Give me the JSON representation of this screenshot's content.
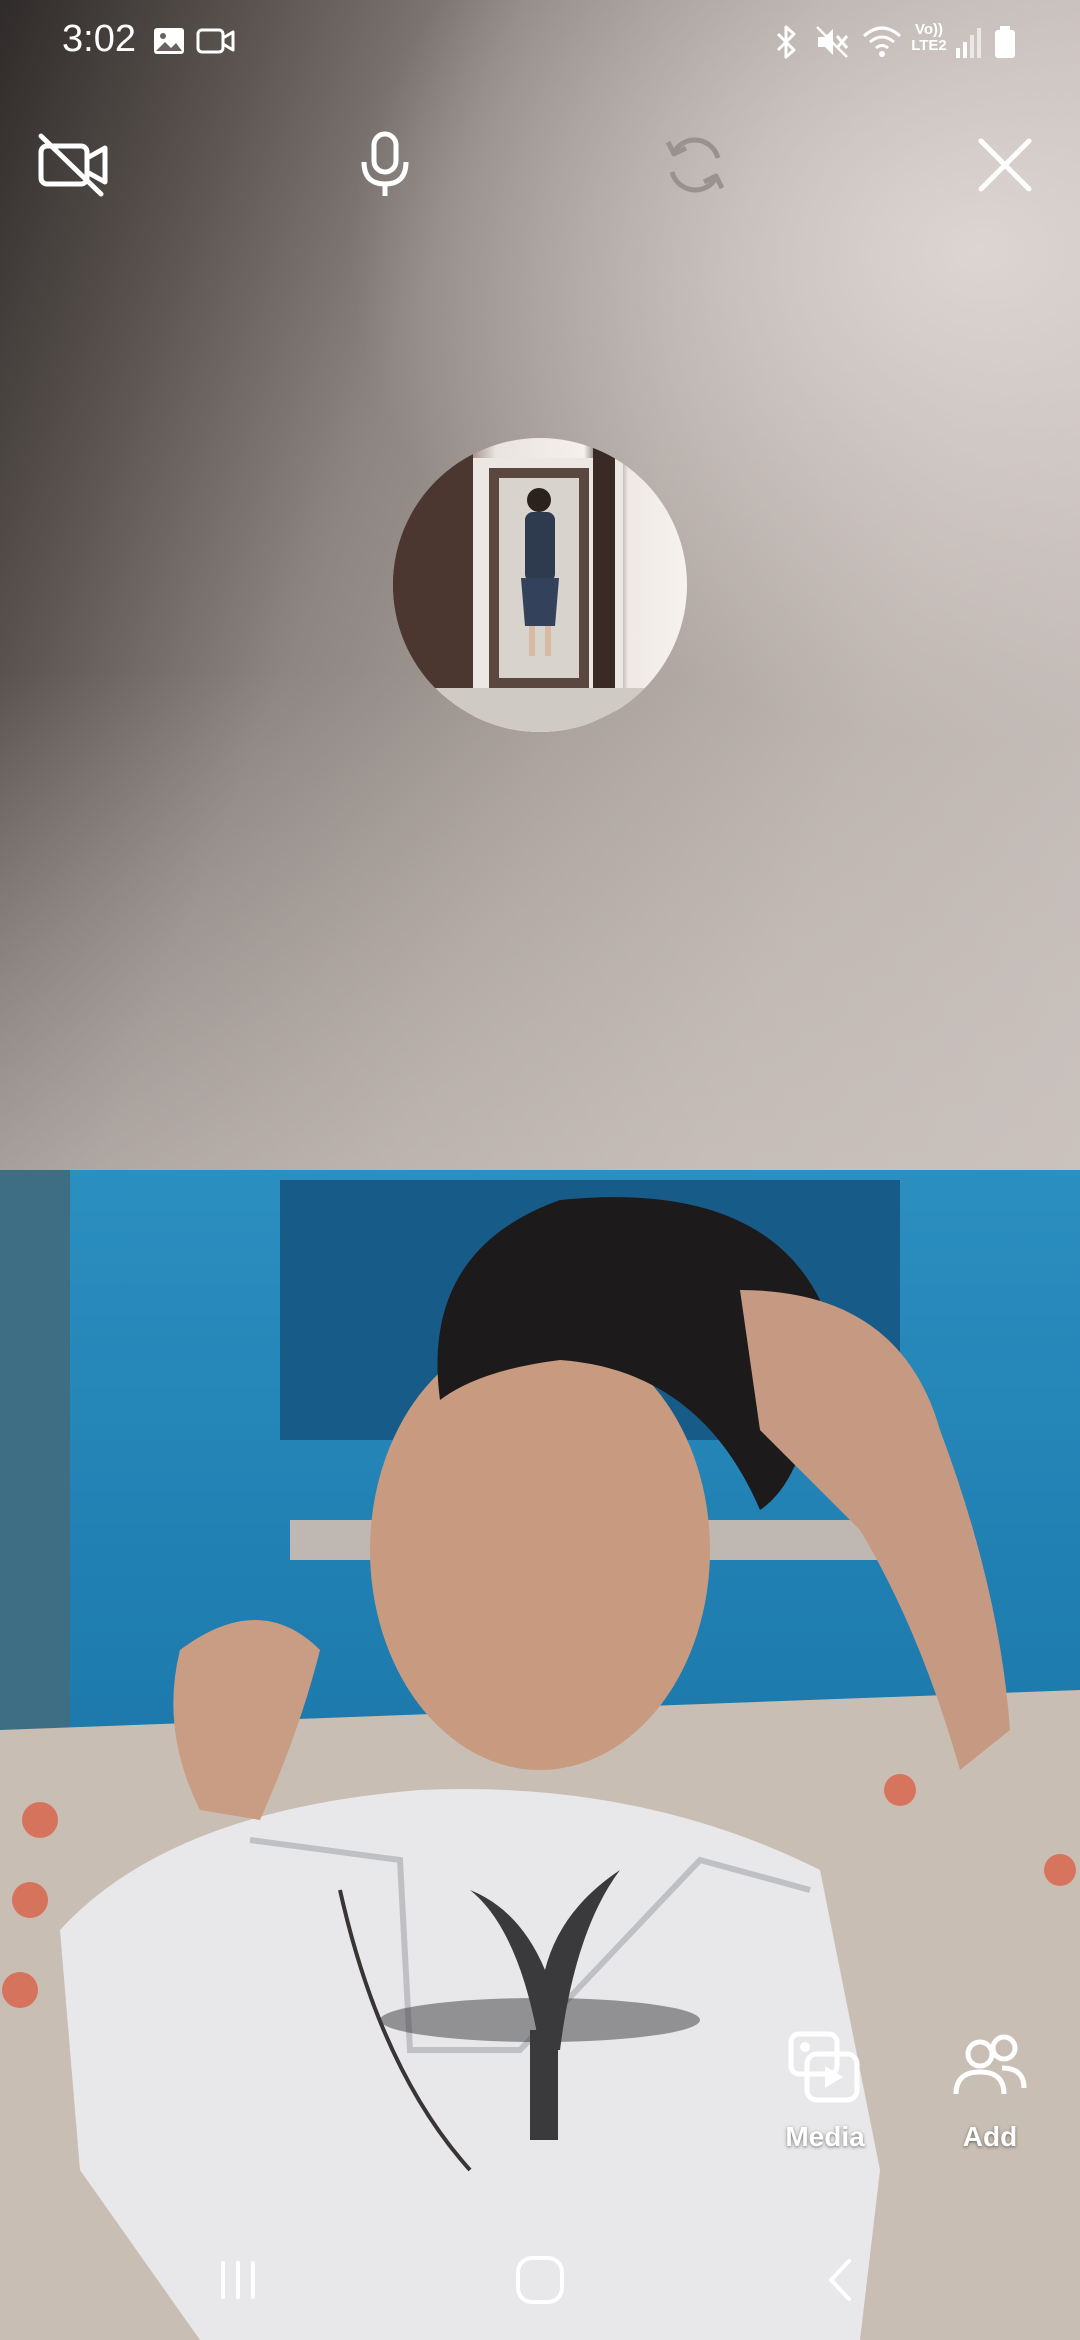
{
  "status_bar": {
    "time": "3:02",
    "left_icons": [
      "gallery-icon",
      "video-icon"
    ],
    "right_icons": [
      "bluetooth-icon",
      "mute-icon",
      "wifi-icon",
      "volte-icon",
      "signal-icon",
      "battery-icon"
    ],
    "network_label_top": "Vo))",
    "network_label_bottom": "LTE2"
  },
  "call_controls": {
    "camera_off": "video-off-icon",
    "microphone": "microphone-icon",
    "switch_camera": "switch-camera-icon",
    "end_call": "close-icon"
  },
  "actions": {
    "media_label": "Media",
    "add_label": "Add"
  },
  "navbar": {
    "recents": "recents-icon",
    "home": "home-icon",
    "back": "back-icon"
  },
  "colors": {
    "icon": "#ffffff",
    "disabled_icon": "#9a9290"
  }
}
